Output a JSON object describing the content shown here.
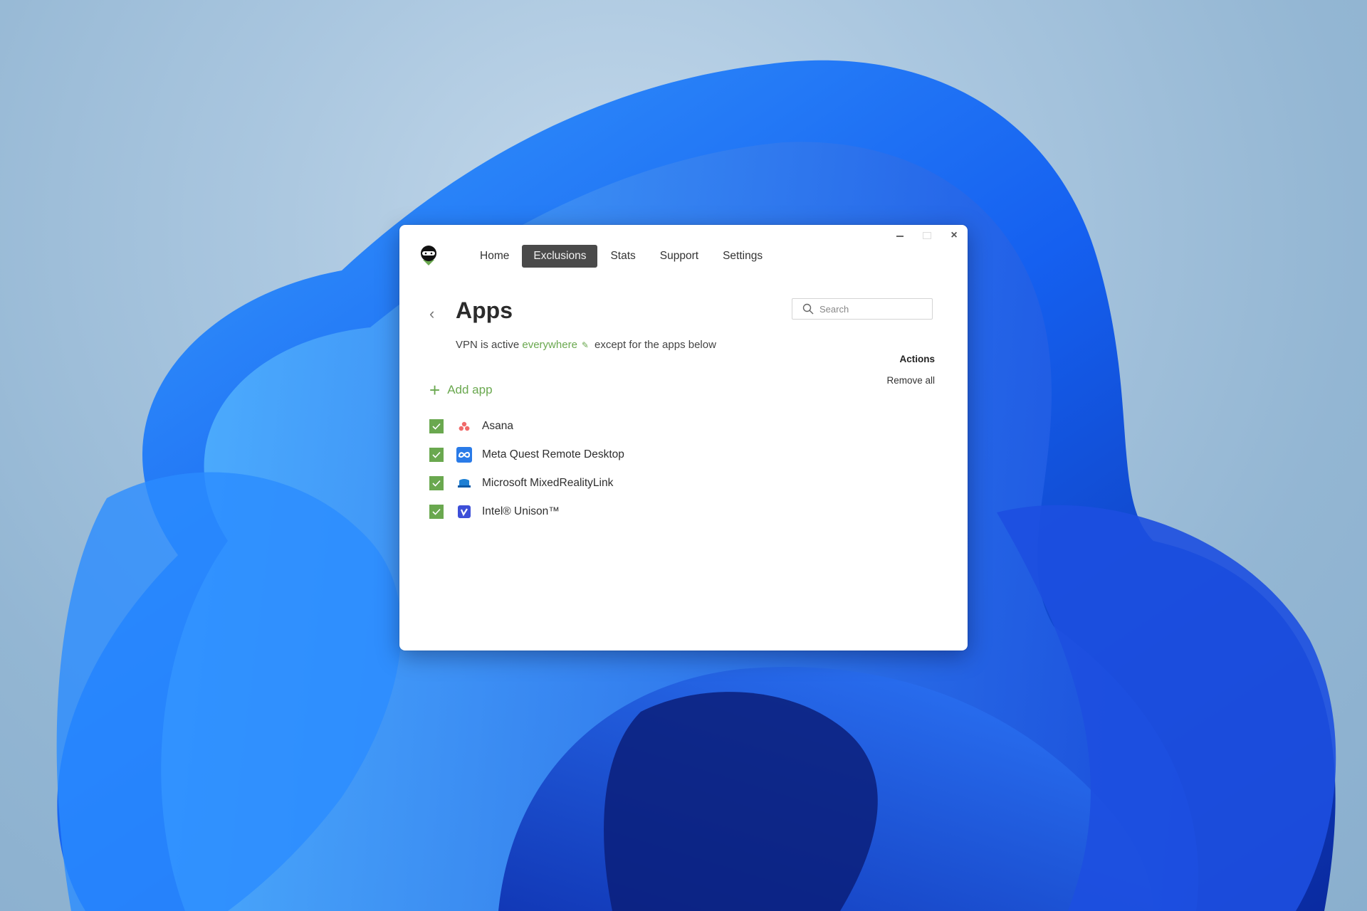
{
  "desktop": {
    "wallpaper": "windows-11-bloom",
    "accent": "#1a5cf0"
  },
  "window": {
    "controls": {
      "minimize": "minimize",
      "maximize": "maximize",
      "close": "×"
    },
    "logo": "ninja-logo",
    "nav": [
      {
        "label": "Home",
        "active": false
      },
      {
        "label": "Exclusions",
        "active": true
      },
      {
        "label": "Stats",
        "active": false
      },
      {
        "label": "Support",
        "active": false
      },
      {
        "label": "Settings",
        "active": false
      }
    ],
    "page": {
      "back_icon": "‹",
      "title": "Apps",
      "subtitle_prefix": "VPN is active",
      "subtitle_link": "everywhere",
      "subtitle_suffix": "except for the apps below",
      "search_placeholder": "Search",
      "actions_heading": "Actions",
      "remove_all": "Remove all",
      "add_app": "Add app"
    },
    "apps": [
      {
        "name": "Asana",
        "checked": true,
        "icon": "asana-icon"
      },
      {
        "name": "Meta Quest Remote Desktop",
        "checked": true,
        "icon": "meta-icon"
      },
      {
        "name": "Microsoft MixedRealityLink",
        "checked": true,
        "icon": "mixed-reality-icon"
      },
      {
        "name": "Intel® Unison™",
        "checked": true,
        "icon": "intel-unison-icon"
      }
    ]
  },
  "colors": {
    "accent_green": "#6aa84f",
    "nav_active_bg": "#4a4a4a"
  }
}
